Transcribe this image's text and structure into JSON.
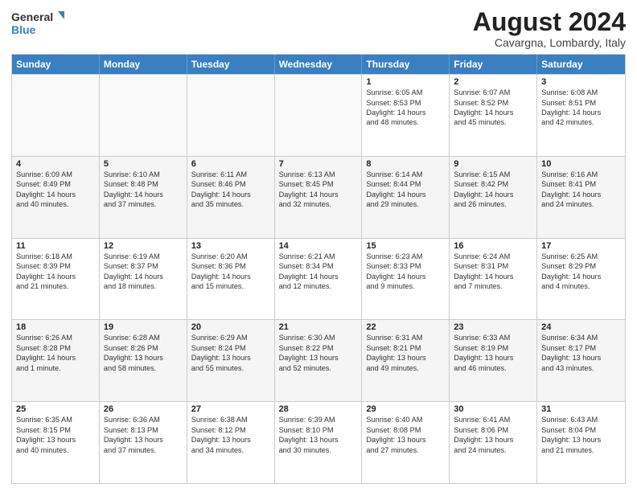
{
  "logo": {
    "line1": "General",
    "line2": "Blue"
  },
  "title": "August 2024",
  "subtitle": "Cavargna, Lombardy, Italy",
  "header_days": [
    "Sunday",
    "Monday",
    "Tuesday",
    "Wednesday",
    "Thursday",
    "Friday",
    "Saturday"
  ],
  "rows": [
    [
      {
        "day": "",
        "text": "",
        "empty": true
      },
      {
        "day": "",
        "text": "",
        "empty": true
      },
      {
        "day": "",
        "text": "",
        "empty": true
      },
      {
        "day": "",
        "text": "",
        "empty": true
      },
      {
        "day": "1",
        "text": "Sunrise: 6:05 AM\nSunset: 8:53 PM\nDaylight: 14 hours\nand 48 minutes."
      },
      {
        "day": "2",
        "text": "Sunrise: 6:07 AM\nSunset: 8:52 PM\nDaylight: 14 hours\nand 45 minutes."
      },
      {
        "day": "3",
        "text": "Sunrise: 6:08 AM\nSunset: 8:51 PM\nDaylight: 14 hours\nand 42 minutes."
      }
    ],
    [
      {
        "day": "4",
        "text": "Sunrise: 6:09 AM\nSunset: 8:49 PM\nDaylight: 14 hours\nand 40 minutes.",
        "alt": true
      },
      {
        "day": "5",
        "text": "Sunrise: 6:10 AM\nSunset: 8:48 PM\nDaylight: 14 hours\nand 37 minutes.",
        "alt": true
      },
      {
        "day": "6",
        "text": "Sunrise: 6:11 AM\nSunset: 8:46 PM\nDaylight: 14 hours\nand 35 minutes.",
        "alt": true
      },
      {
        "day": "7",
        "text": "Sunrise: 6:13 AM\nSunset: 8:45 PM\nDaylight: 14 hours\nand 32 minutes.",
        "alt": true
      },
      {
        "day": "8",
        "text": "Sunrise: 6:14 AM\nSunset: 8:44 PM\nDaylight: 14 hours\nand 29 minutes.",
        "alt": true
      },
      {
        "day": "9",
        "text": "Sunrise: 6:15 AM\nSunset: 8:42 PM\nDaylight: 14 hours\nand 26 minutes.",
        "alt": true
      },
      {
        "day": "10",
        "text": "Sunrise: 6:16 AM\nSunset: 8:41 PM\nDaylight: 14 hours\nand 24 minutes.",
        "alt": true
      }
    ],
    [
      {
        "day": "11",
        "text": "Sunrise: 6:18 AM\nSunset: 8:39 PM\nDaylight: 14 hours\nand 21 minutes."
      },
      {
        "day": "12",
        "text": "Sunrise: 6:19 AM\nSunset: 8:37 PM\nDaylight: 14 hours\nand 18 minutes."
      },
      {
        "day": "13",
        "text": "Sunrise: 6:20 AM\nSunset: 8:36 PM\nDaylight: 14 hours\nand 15 minutes."
      },
      {
        "day": "14",
        "text": "Sunrise: 6:21 AM\nSunset: 8:34 PM\nDaylight: 14 hours\nand 12 minutes."
      },
      {
        "day": "15",
        "text": "Sunrise: 6:23 AM\nSunset: 8:33 PM\nDaylight: 14 hours\nand 9 minutes."
      },
      {
        "day": "16",
        "text": "Sunrise: 6:24 AM\nSunset: 8:31 PM\nDaylight: 14 hours\nand 7 minutes."
      },
      {
        "day": "17",
        "text": "Sunrise: 6:25 AM\nSunset: 8:29 PM\nDaylight: 14 hours\nand 4 minutes."
      }
    ],
    [
      {
        "day": "18",
        "text": "Sunrise: 6:26 AM\nSunset: 8:28 PM\nDaylight: 14 hours\nand 1 minute.",
        "alt": true
      },
      {
        "day": "19",
        "text": "Sunrise: 6:28 AM\nSunset: 8:26 PM\nDaylight: 13 hours\nand 58 minutes.",
        "alt": true
      },
      {
        "day": "20",
        "text": "Sunrise: 6:29 AM\nSunset: 8:24 PM\nDaylight: 13 hours\nand 55 minutes.",
        "alt": true
      },
      {
        "day": "21",
        "text": "Sunrise: 6:30 AM\nSunset: 8:22 PM\nDaylight: 13 hours\nand 52 minutes.",
        "alt": true
      },
      {
        "day": "22",
        "text": "Sunrise: 6:31 AM\nSunset: 8:21 PM\nDaylight: 13 hours\nand 49 minutes.",
        "alt": true
      },
      {
        "day": "23",
        "text": "Sunrise: 6:33 AM\nSunset: 8:19 PM\nDaylight: 13 hours\nand 46 minutes.",
        "alt": true
      },
      {
        "day": "24",
        "text": "Sunrise: 6:34 AM\nSunset: 8:17 PM\nDaylight: 13 hours\nand 43 minutes.",
        "alt": true
      }
    ],
    [
      {
        "day": "25",
        "text": "Sunrise: 6:35 AM\nSunset: 8:15 PM\nDaylight: 13 hours\nand 40 minutes."
      },
      {
        "day": "26",
        "text": "Sunrise: 6:36 AM\nSunset: 8:13 PM\nDaylight: 13 hours\nand 37 minutes."
      },
      {
        "day": "27",
        "text": "Sunrise: 6:38 AM\nSunset: 8:12 PM\nDaylight: 13 hours\nand 34 minutes."
      },
      {
        "day": "28",
        "text": "Sunrise: 6:39 AM\nSunset: 8:10 PM\nDaylight: 13 hours\nand 30 minutes."
      },
      {
        "day": "29",
        "text": "Sunrise: 6:40 AM\nSunset: 8:08 PM\nDaylight: 13 hours\nand 27 minutes."
      },
      {
        "day": "30",
        "text": "Sunrise: 6:41 AM\nSunset: 8:06 PM\nDaylight: 13 hours\nand 24 minutes."
      },
      {
        "day": "31",
        "text": "Sunrise: 6:43 AM\nSunset: 8:04 PM\nDaylight: 13 hours\nand 21 minutes."
      }
    ]
  ]
}
